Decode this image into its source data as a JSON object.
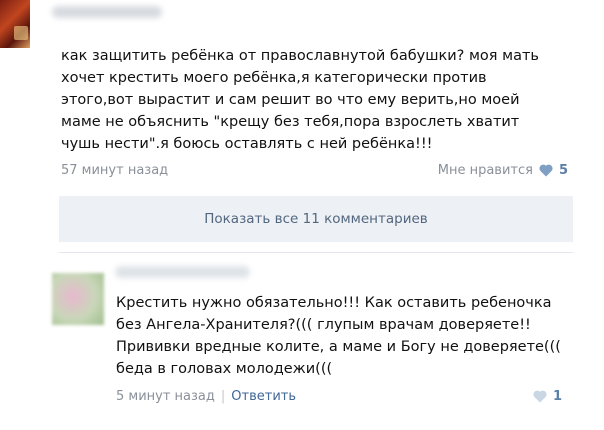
{
  "post": {
    "text": "как защитить ребёнка от православнутой бабушки? моя мать\nхочет крестить моего ребёнка,я категорически против\nэтого,вот вырастит и сам решит во что ему верить,но моей\nмаме не объяснить \"крещу без тебя,пора взрослеть хватит\nчушь нести\".я боюсь оставлять с ней ребёнка!!!",
    "time": "57 минут назад",
    "like_label": "Мне нравится",
    "like_count": "5"
  },
  "show_all_label": "Показать все 11 комментариев",
  "comment": {
    "text": "Крестить нужно обязательно!!! Как оставить ребеночка\nбез Ангела-Хранителя?((( глупым врачам доверяете!!\nПрививки вредные колите, а маме и Богу не доверяете(((\nбеда в головах молодежи(((",
    "time": "5 минут назад",
    "separator": "|",
    "reply_label": "Ответить",
    "like_count": "1"
  },
  "colors": {
    "accent": "#5b7fa6",
    "heart_active": "#7f9fc4",
    "heart_inactive": "#c9d6e3"
  },
  "icons": [
    "heart-icon",
    "heart-icon"
  ]
}
